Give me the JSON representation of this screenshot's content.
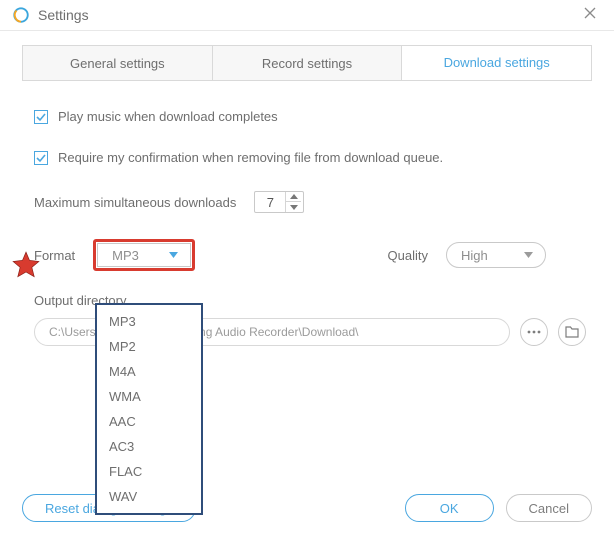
{
  "window": {
    "title": "Settings"
  },
  "tabs": {
    "general": "General settings",
    "record": "Record settings",
    "download": "Download settings"
  },
  "opts": {
    "play_on_complete": "Play music when download completes",
    "confirm_remove": "Require my confirmation when removing file from download queue.",
    "max_dl_label": "Maximum simultaneous downloads",
    "max_dl_value": "7",
    "format_label": "Format",
    "format_value": "MP3",
    "quality_label": "Quality",
    "quality_value": "High",
    "output_label": "Output directory",
    "output_path": "C:\\Users\\                        powersoft\\Streaming Audio Recorder\\Download\\"
  },
  "format_options": [
    "MP3",
    "MP2",
    "M4A",
    "WMA",
    "AAC",
    "AC3",
    "FLAC",
    "WAV"
  ],
  "buttons": {
    "reset": "Reset dialog warnings",
    "ok": "OK",
    "cancel": "Cancel"
  }
}
